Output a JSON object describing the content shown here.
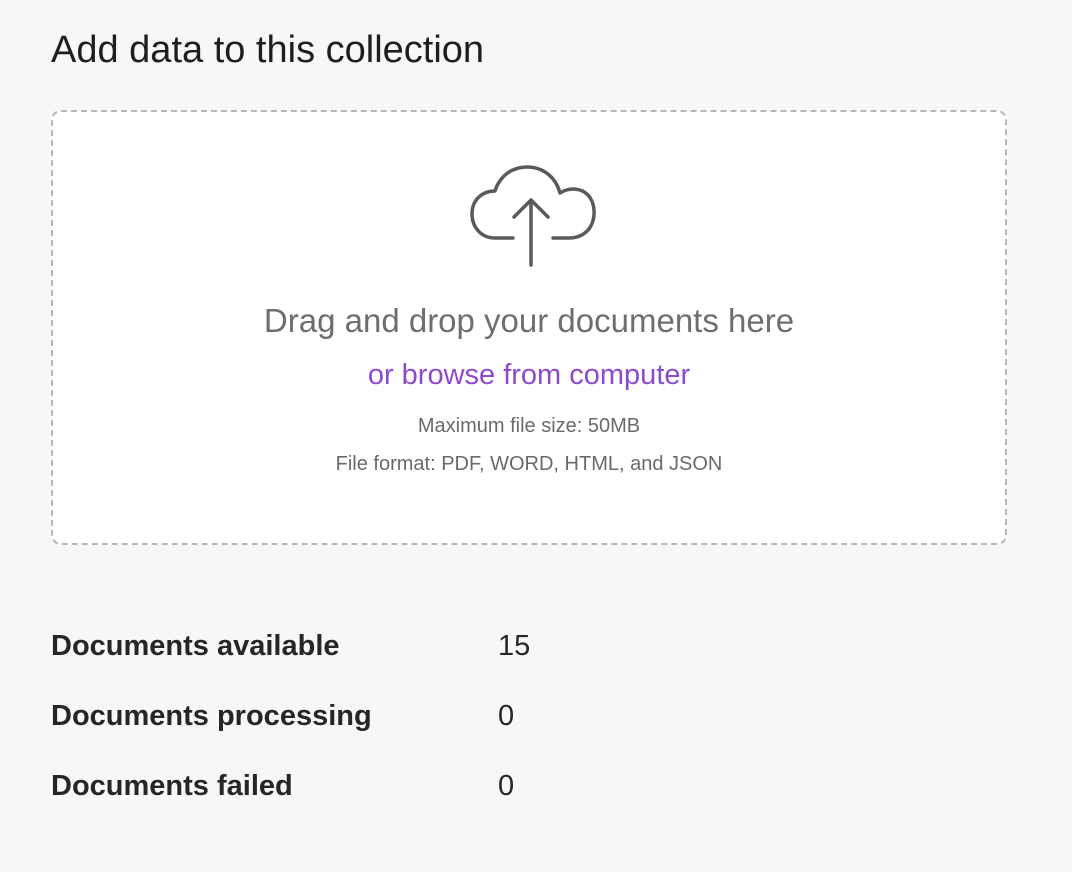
{
  "header": {
    "title": "Add data to this collection"
  },
  "dropzone": {
    "icon": "cloud-upload-icon",
    "drag_text": "Drag and drop your documents here",
    "browse_text": "or browse from computer",
    "max_size": "Maximum file size: 50MB",
    "formats": "File format: PDF, WORD, HTML, and JSON",
    "link_color": "#8f49cf"
  },
  "stats": [
    {
      "label": "Documents available",
      "value": "15"
    },
    {
      "label": "Documents processing",
      "value": "0"
    },
    {
      "label": "Documents failed",
      "value": "0"
    }
  ]
}
